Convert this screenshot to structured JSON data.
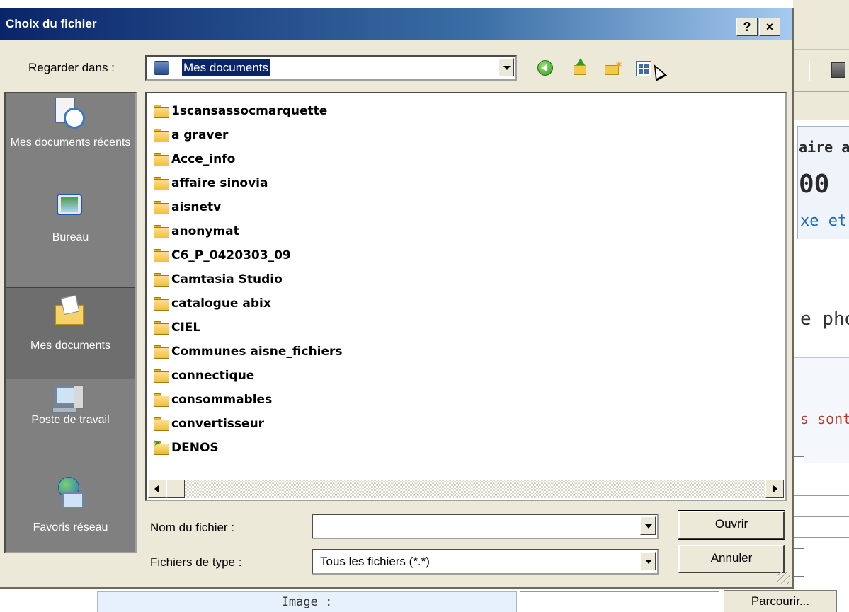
{
  "dialog": {
    "title": "Choix du fichier",
    "help_label": "?",
    "close_label": "×",
    "look_in_label": "Regarder dans :",
    "look_in_value": "Mes documents"
  },
  "places": [
    {
      "label": "Mes documents récents",
      "icon": "recent-documents-icon"
    },
    {
      "label": "Bureau",
      "icon": "desktop-icon"
    },
    {
      "label": "Mes documents",
      "icon": "my-documents-icon",
      "active": true
    },
    {
      "label": "Poste de travail",
      "icon": "my-computer-icon"
    },
    {
      "label": "Favoris réseau",
      "icon": "network-places-icon"
    }
  ],
  "files": [
    {
      "name": "1scansassocmarquette",
      "icon": "folder-icon"
    },
    {
      "name": "a graver",
      "icon": "folder-icon"
    },
    {
      "name": "Acce_info",
      "icon": "folder-icon"
    },
    {
      "name": "affaire sinovia",
      "icon": "folder-icon"
    },
    {
      "name": "aisnetv",
      "icon": "folder-icon"
    },
    {
      "name": "anonymat",
      "icon": "folder-icon"
    },
    {
      "name": "C6_P_0420303_09",
      "icon": "folder-icon"
    },
    {
      "name": "Camtasia Studio",
      "icon": "folder-icon"
    },
    {
      "name": "catalogue abix",
      "icon": "folder-icon"
    },
    {
      "name": "CIEL",
      "icon": "folder-icon"
    },
    {
      "name": "Communes aisne_fichiers",
      "icon": "folder-icon"
    },
    {
      "name": "connectique",
      "icon": "folder-icon"
    },
    {
      "name": "consommables",
      "icon": "folder-icon"
    },
    {
      "name": "convertisseur",
      "icon": "folder-icon"
    },
    {
      "name": "DENOS",
      "icon": "special-folder-icon"
    }
  ],
  "form": {
    "file_name_label": "Nom du fichier :",
    "file_name_value": "",
    "file_type_label": "Fichiers de type :",
    "file_type_value": "Tous les fichiers (*.*)",
    "open_label": "Ouvrir",
    "cancel_label": "Annuler"
  },
  "background_page": {
    "text1": "aire a",
    "text2": "00",
    "text3": "xe et",
    "text4": "e pho",
    "text5": "s sont",
    "image_label": "Image :",
    "browse_label": "Parcourir..."
  }
}
